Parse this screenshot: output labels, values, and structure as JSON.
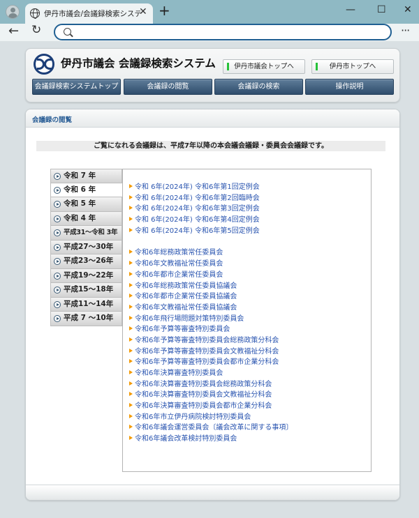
{
  "browser": {
    "tab_title": "伊丹市議会/会議録検索システム",
    "tab_close": "✕",
    "new_tab": "+",
    "address": ""
  },
  "header": {
    "site_title": "伊丹市議会 会議録検索システム",
    "ext_buttons": [
      "伊丹市議会トップへ",
      "伊丹市トップへ"
    ],
    "menu": [
      "会議録検索システムトップ",
      "会議録の閲覧",
      "会議録の検索",
      "操作説明"
    ]
  },
  "main": {
    "panel_title": "会議録の閲覧",
    "intro": "ご覧になれる会議録は、平成7年以降の本会議会議録・委員会会議録です。",
    "years": [
      {
        "label": "令和 7 年",
        "active": false
      },
      {
        "label": "令和 6 年",
        "active": true
      },
      {
        "label": "令和 5 年",
        "active": false
      },
      {
        "label": "令和 4 年",
        "active": false
      },
      {
        "label": "平成31～令和 3年",
        "active": false
      },
      {
        "label": "平成27～30年",
        "active": false
      },
      {
        "label": "平成23～26年",
        "active": false
      },
      {
        "label": "平成19～22年",
        "active": false
      },
      {
        "label": "平成15～18年",
        "active": false
      },
      {
        "label": "平成11～14年",
        "active": false
      },
      {
        "label": "平成 7 ～10年",
        "active": false
      }
    ],
    "plenary": [
      "令和 6年(2024年) 令和6年第1回定例会",
      "令和 6年(2024年) 令和6年第2回臨時会",
      "令和 6年(2024年) 令和6年第3回定例会",
      "令和 6年(2024年) 令和6年第4回定例会",
      "令和 6年(2024年) 令和6年第5回定例会"
    ],
    "committees": [
      "令和6年総務政策常任委員会",
      "令和6年文教福祉常任委員会",
      "令和6年都市企業常任委員会",
      "令和6年総務政策常任委員協議会",
      "令和6年都市企業常任委員協議会",
      "令和6年文教福祉常任委員協議会",
      "令和6年飛行場問題対策特別委員会",
      "令和6年予算等審査特別委員会",
      "令和6年予算等審査特別委員会総務政策分科会",
      "令和6年予算等審査特別委員会文教福祉分科会",
      "令和6年予算等審査特別委員会都市企業分科会",
      "令和6年決算審査特別委員会",
      "令和6年決算審査特別委員会総務政策分科会",
      "令和6年決算審査特別委員会文教福祉分科会",
      "令和6年決算審査特別委員会都市企業分科会",
      "令和6年市立伊丹病院検討特別委員会",
      "令和6年議会運営委員会〔議会改革に関する事項〕",
      "令和6年議会改革検討特別委員会"
    ]
  }
}
